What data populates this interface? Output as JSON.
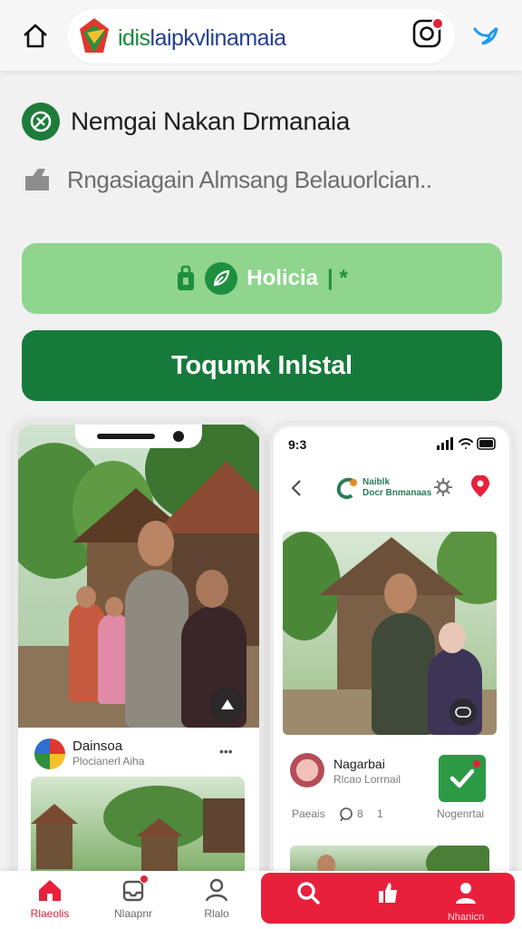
{
  "topbar": {
    "home_icon": "home-icon",
    "url_text_lead": "idis",
    "url_text_rest": "laipkvlinamaia",
    "instagram_icon": "instagram-icon",
    "twitter_icon": "twitter-icon"
  },
  "header": {
    "site_title": "Nemgai Nakan Drmanaia",
    "subtitle": "Rngasiagain Almsang Belauorlcian.."
  },
  "buttons": {
    "light_label": "Holicia",
    "light_sep": "| *",
    "dark_label": "Toqumk Inlstal"
  },
  "phone_left": {
    "post_name": "Dainsoa",
    "post_sub": "Plocianerl Aiha",
    "more_label": "•••"
  },
  "phone_right": {
    "status_time": "9:3",
    "app_name_line1": "Naiblk",
    "app_name_line2": "Docr Bnmanaas",
    "post_name": "Nagarbai",
    "post_sub": "Rlcao Lorrnail",
    "stats_left": "Paeais",
    "stats_mid": "8",
    "stats_right": "1",
    "stats_end": "Nogenrtai"
  },
  "tabbar": {
    "tabs": [
      {
        "label": "Rlaeolis",
        "icon": "home-icon"
      },
      {
        "label": "Nlaapnr",
        "icon": "inbox-icon"
      },
      {
        "label": "Rlalo",
        "icon": "profile-icon"
      }
    ],
    "red_tabs": [
      {
        "label": "",
        "icon": "search-icon"
      },
      {
        "label": "",
        "icon": "like-icon"
      },
      {
        "label": "Nhanicn",
        "icon": "user-icon"
      }
    ]
  },
  "colors": {
    "brand_green": "#167b3a",
    "light_green": "#8fd58e",
    "accent_red": "#e9203b"
  }
}
